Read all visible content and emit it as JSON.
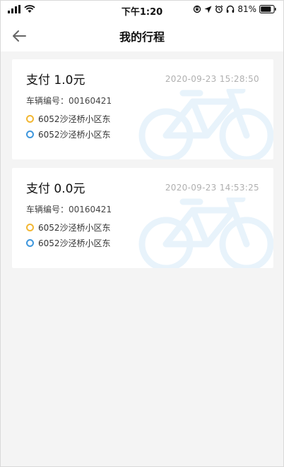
{
  "status_bar": {
    "time": "下午1:20",
    "battery": "81%",
    "icons": [
      "signal-icon",
      "wifi-icon",
      "orientation-lock-icon",
      "location-arrow-icon",
      "alarm-icon",
      "headphones-icon",
      "battery-icon"
    ]
  },
  "nav": {
    "title": "我的行程",
    "back_icon": "arrow-left-icon"
  },
  "trips": [
    {
      "amount": "支付 1.0元",
      "time": "2020-09-23 15:28:50",
      "vehicle": "车辆编号：00160421",
      "start": "6052沙泾桥小区东",
      "end": "6052沙泾桥小区东"
    },
    {
      "amount": "支付 0.0元",
      "time": "2020-09-23 14:53:25",
      "vehicle": "车辆编号：00160421",
      "start": "6052沙泾桥小区东",
      "end": "6052沙泾桥小区东"
    }
  ],
  "colors": {
    "start_dot": "#f2b733",
    "end_dot": "#3f97dd",
    "bike_watermark": "#e8f3fb",
    "background": "#f4f4f4"
  }
}
